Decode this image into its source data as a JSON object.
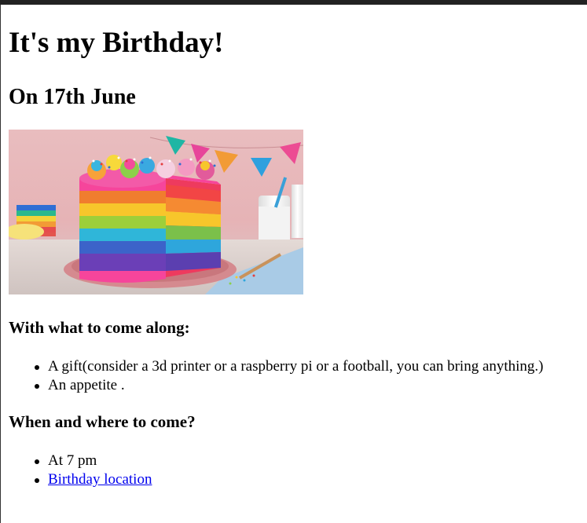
{
  "page": {
    "title": "It's my Birthday!",
    "subtitle": "On 17th June"
  },
  "image": {
    "alt": "Rainbow layer birthday cake",
    "icon": "cake-image"
  },
  "section_bring": {
    "heading": "With what to come along:",
    "items": [
      "A gift(consider a 3d printer or a raspberry pi or a football, you can bring anything.)",
      "An appetite ."
    ]
  },
  "section_when": {
    "heading": "When and where to come?",
    "time": "At 7 pm",
    "location_link": "Birthday location"
  },
  "colors": {
    "link": "#0000ee",
    "topbar": "#222222"
  }
}
